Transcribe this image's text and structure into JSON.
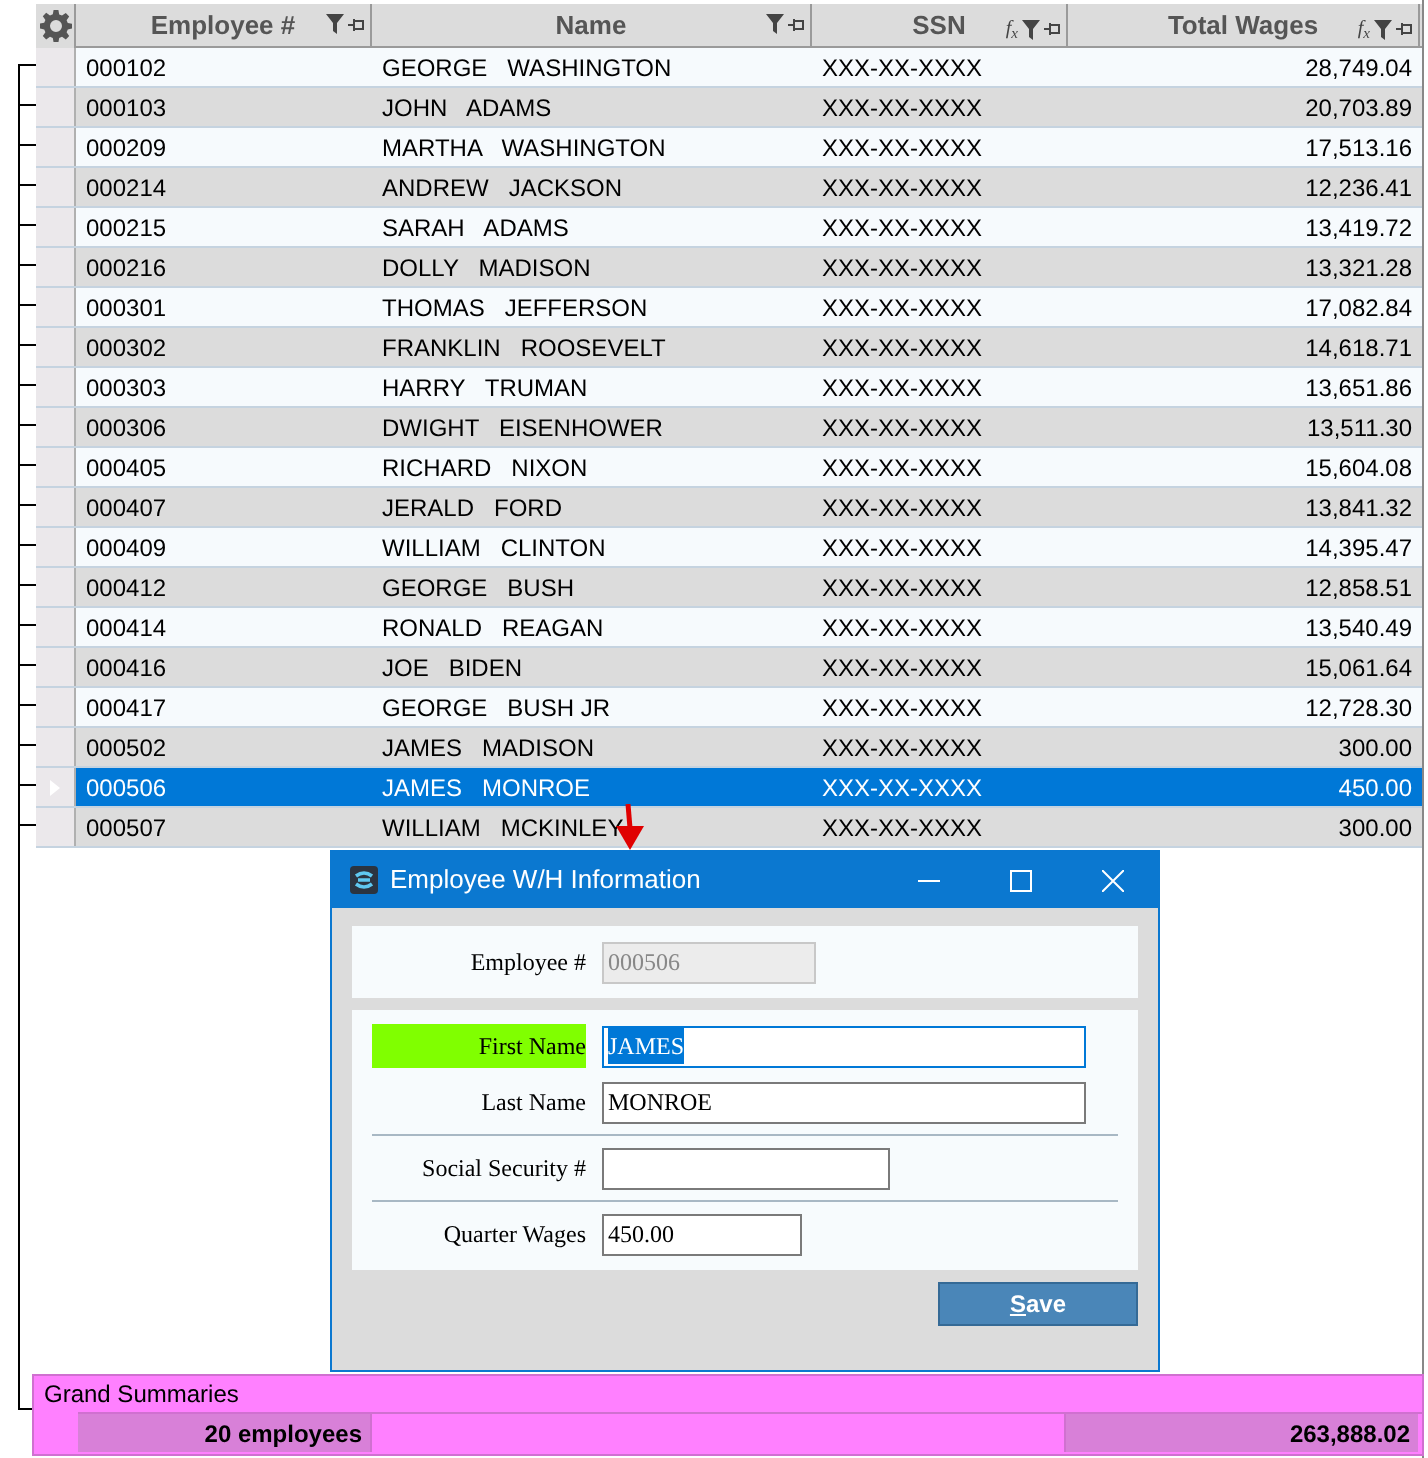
{
  "grid": {
    "columns": [
      {
        "label": "Employee #"
      },
      {
        "label": "Name"
      },
      {
        "label": "SSN",
        "formula": "f$_{x}$"
      },
      {
        "label": "Total Wages",
        "formula": "f$_{x}$"
      }
    ],
    "rows": [
      {
        "cells": [
          "000102",
          "GEORGE   WASHINGTON",
          "XXX-XX-XXXX",
          "28,749.04"
        ],
        "selected": false
      },
      {
        "cells": [
          "000103",
          "JOHN   ADAMS",
          "XXX-XX-XXXX",
          "20,703.89"
        ],
        "selected": false
      },
      {
        "cells": [
          "000209",
          "MARTHA   WASHINGTON",
          "XXX-XX-XXXX",
          "17,513.16"
        ],
        "selected": false
      },
      {
        "cells": [
          "000214",
          "ANDREW   JACKSON",
          "XXX-XX-XXXX",
          "12,236.41"
        ],
        "selected": false
      },
      {
        "cells": [
          "000215",
          "SARAH   ADAMS",
          "XXX-XX-XXXX",
          "13,419.72"
        ],
        "selected": false
      },
      {
        "cells": [
          "000216",
          "DOLLY   MADISON",
          "XXX-XX-XXXX",
          "13,321.28"
        ],
        "selected": false
      },
      {
        "cells": [
          "000301",
          "THOMAS   JEFFERSON",
          "XXX-XX-XXXX",
          "17,082.84"
        ],
        "selected": false
      },
      {
        "cells": [
          "000302",
          "FRANKLIN   ROOSEVELT",
          "XXX-XX-XXXX",
          "14,618.71"
        ],
        "selected": false
      },
      {
        "cells": [
          "000303",
          "HARRY   TRUMAN",
          "XXX-XX-XXXX",
          "13,651.86"
        ],
        "selected": false
      },
      {
        "cells": [
          "000306",
          "DWIGHT   EISENHOWER",
          "XXX-XX-XXXX",
          "13,511.30"
        ],
        "selected": false
      },
      {
        "cells": [
          "000405",
          "RICHARD   NIXON",
          "XXX-XX-XXXX",
          "15,604.08"
        ],
        "selected": false
      },
      {
        "cells": [
          "000407",
          "JERALD   FORD",
          "XXX-XX-XXXX",
          "13,841.32"
        ],
        "selected": false
      },
      {
        "cells": [
          "000409",
          "WILLIAM   CLINTON",
          "XXX-XX-XXXX",
          "14,395.47"
        ],
        "selected": false
      },
      {
        "cells": [
          "000412",
          "GEORGE   BUSH",
          "XXX-XX-XXXX",
          "12,858.51"
        ],
        "selected": false
      },
      {
        "cells": [
          "000414",
          "RONALD   REAGAN",
          "XXX-XX-XXXX",
          "13,540.49"
        ],
        "selected": false
      },
      {
        "cells": [
          "000416",
          "JOE   BIDEN",
          "XXX-XX-XXXX",
          "15,061.64"
        ],
        "selected": false
      },
      {
        "cells": [
          "000417",
          "GEORGE   BUSH JR",
          "XXX-XX-XXXX",
          "12,728.30"
        ],
        "selected": false
      },
      {
        "cells": [
          "000502",
          "JAMES   MADISON",
          "XXX-XX-XXXX",
          "300.00"
        ],
        "selected": false
      },
      {
        "cells": [
          "000506",
          "JAMES   MONROE",
          "XXX-XX-XXXX",
          "450.00"
        ],
        "selected": true
      },
      {
        "cells": [
          "000507",
          "WILLIAM   MCKINLEY",
          "XXX-XX-XXXX",
          "300.00"
        ],
        "selected": false
      }
    ]
  },
  "summary": {
    "title": "Grand Summaries",
    "count": "20 employees",
    "total": "263,888.02"
  },
  "dialog": {
    "title": "Employee W/H Information",
    "sections": [
      [
        [
          {
            "label": "Employee #",
            "value": "000506",
            "kind": "id",
            "disabled": true,
            "focused": false,
            "highlighted": false
          }
        ]
      ],
      [
        [
          {
            "label": "First Name",
            "value": "JAMES",
            "kind": "name",
            "disabled": false,
            "focused": true,
            "highlighted": true
          },
          {
            "label": "Last Name",
            "value": "MONROE",
            "kind": "name",
            "disabled": false,
            "focused": false,
            "highlighted": false
          }
        ],
        [
          {
            "label": "Social Security #",
            "kind": "ssn",
            "disabled": false,
            "focused": false,
            "highlighted": false
          }
        ],
        [
          {
            "label": "Quarter Wages",
            "value": "450.00",
            "kind": "money",
            "disabled": false,
            "focused": false,
            "highlighted": false
          }
        ]
      ]
    ],
    "save": {
      "label": "Save"
    }
  }
}
